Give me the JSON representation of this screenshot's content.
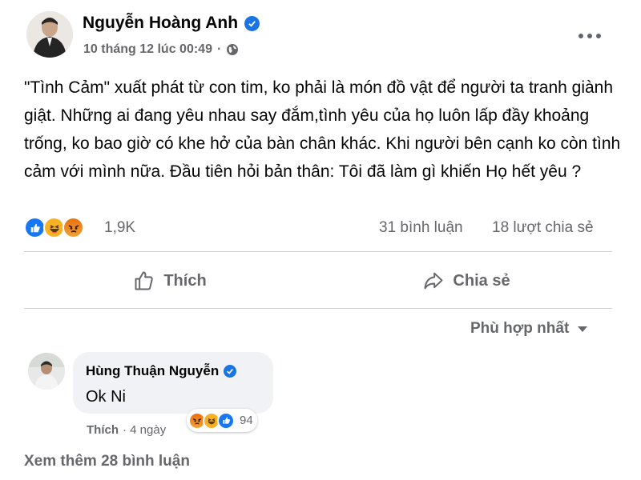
{
  "post": {
    "author": "Nguyễn Hoàng Anh",
    "timestamp": "10 tháng 12 lúc 00:49",
    "separator": "·",
    "audience_icon": "globe-icon",
    "more_icon": "more-dots-icon",
    "text": "\"Tình Cảm\" xuất phát từ con tim,  ko phải là món đồ vật để người ta tranh giành giật. Những ai đang yêu nhau say đắm,tình yêu của họ luôn lấp đầy khoảng trống, ko bao giờ có khe hở của bàn chân khác. Khi người bên cạnh ko còn tình cảm với mình nữa. Đầu tiên hỏi bản thân: Tôi đã làm gì khiến Họ hết yêu ?"
  },
  "stats": {
    "reaction_icons": [
      "like-icon",
      "haha-icon",
      "angry-icon"
    ],
    "reaction_count": "1,9K",
    "comments": "31 bình luận",
    "shares": "18 lượt chia sẻ"
  },
  "actions": {
    "like_label": "Thích",
    "share_label": "Chia sẻ"
  },
  "sort": {
    "label": "Phù hợp nhất"
  },
  "comment": {
    "author": "Hùng Thuận Nguyễn",
    "text": "Ok Ni",
    "like_label": "Thích",
    "time": "· 4 ngày",
    "reaction_icons": [
      "angry-icon",
      "haha-icon",
      "like-icon"
    ],
    "reaction_count": "94"
  },
  "see_more": "Xem thêm 28 bình luận",
  "colors": {
    "verified": "#1b74e4",
    "secondary_text": "#65676b",
    "like_blue": "#1877f2",
    "comment_bubble": "#f0f2f5"
  }
}
